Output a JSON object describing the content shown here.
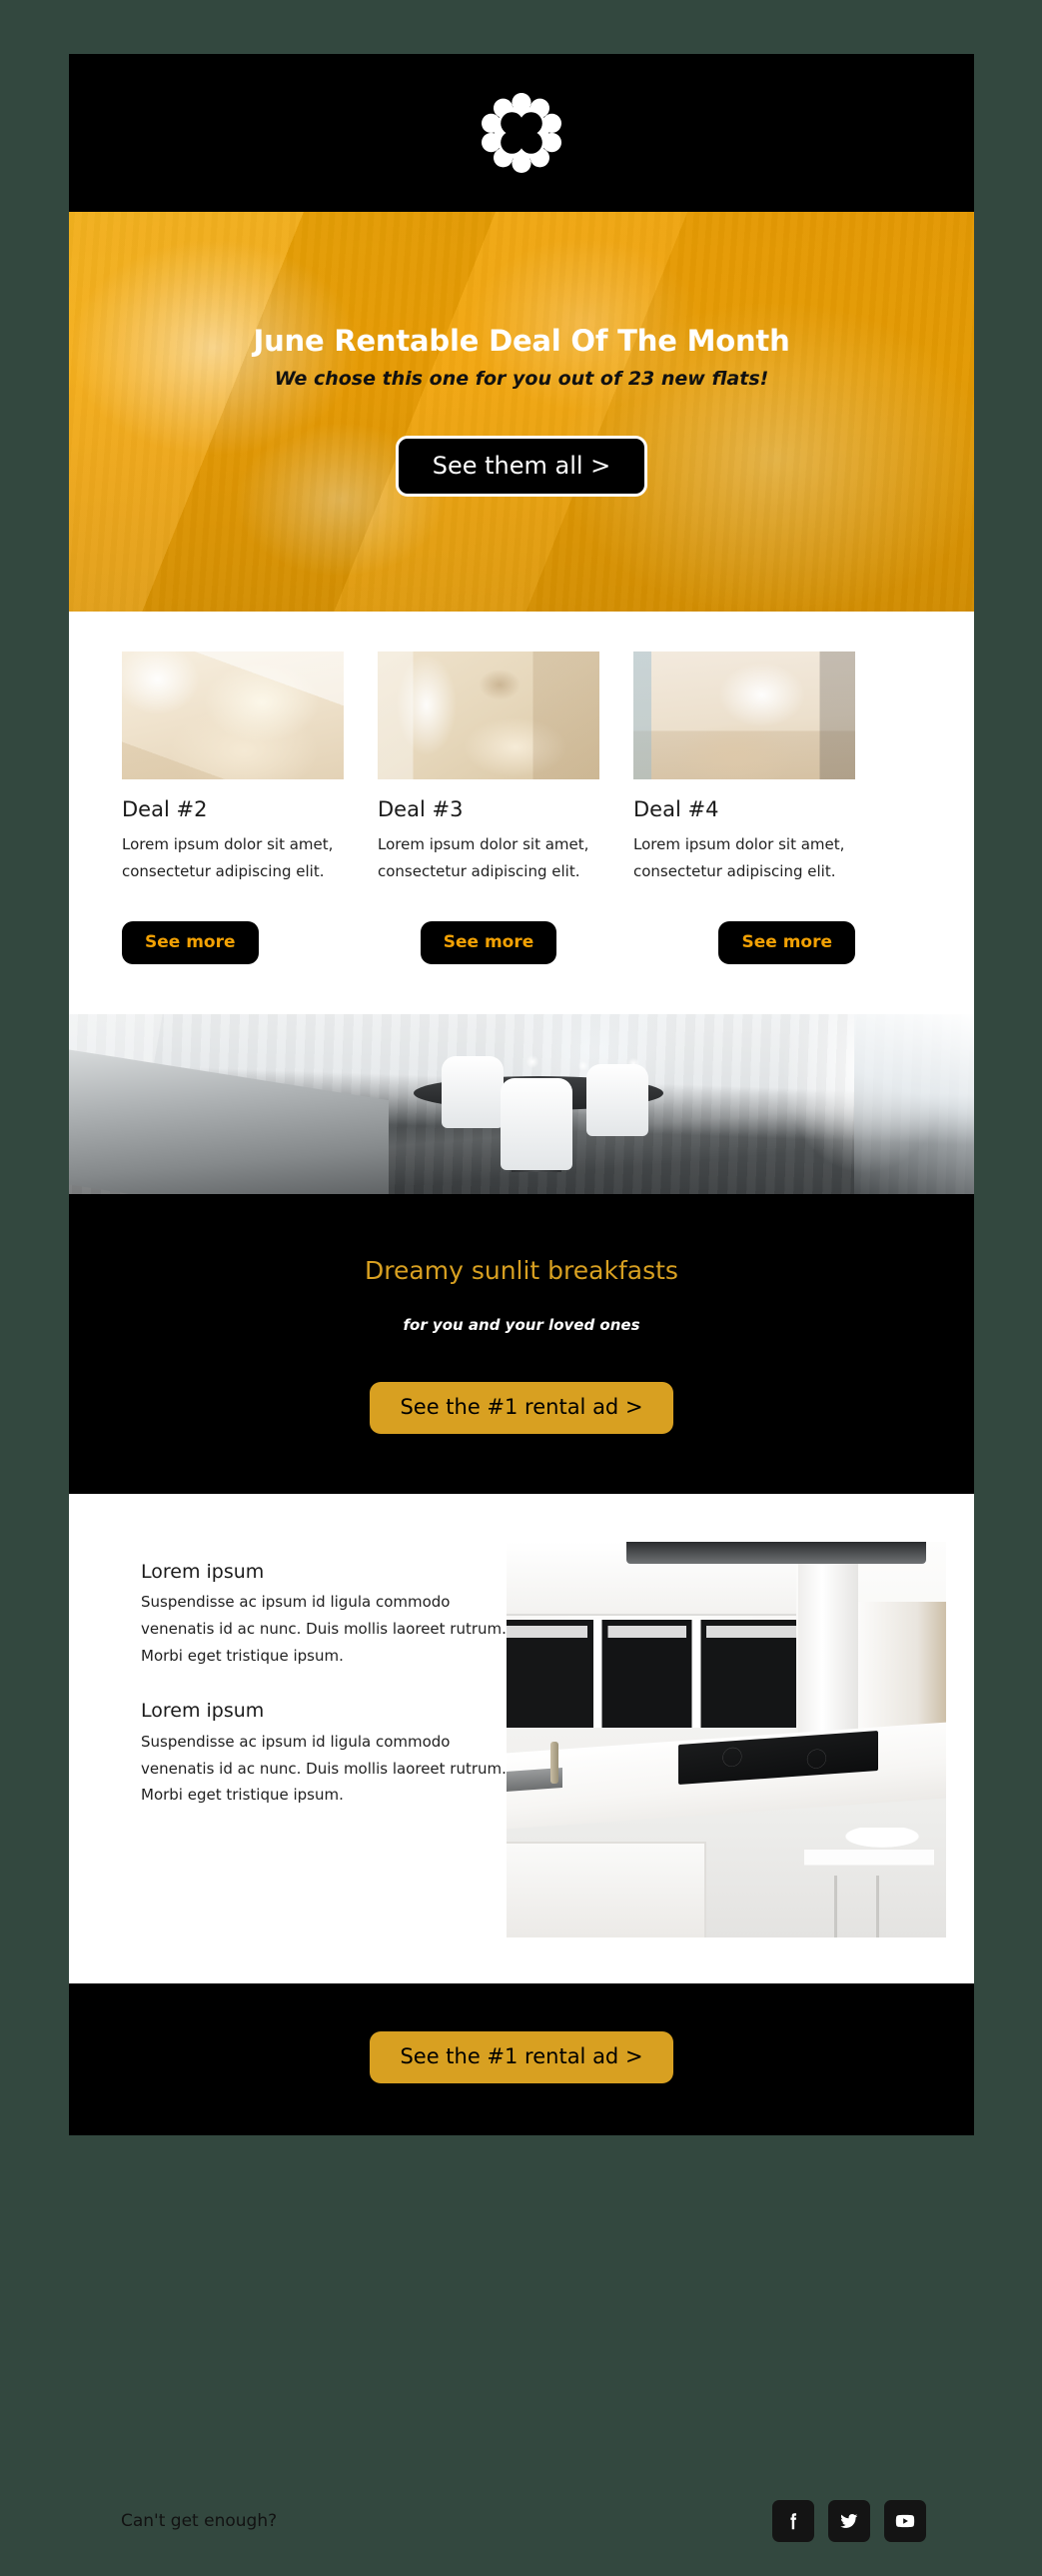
{
  "theme": {
    "page_background": "#33483f",
    "email_background": "#ffffff",
    "black": "#000000",
    "hero_yellow": "#f2a204",
    "accent_gold": "#d8a021",
    "see_more_text": "#f2a104"
  },
  "header": {
    "logo_icon": "flower-scallop-logo"
  },
  "hero": {
    "title": "June Rentable Deal Of The Month",
    "subtitle": "We chose this one for you out of 23 new flats!",
    "cta_label": "See them all >",
    "image_alt": "yellow-tinted-bedroom-photo"
  },
  "deals": {
    "items": [
      {
        "title": "Deal #2",
        "body": "Lorem ipsum dolor sit amet, consectetur adipiscing elit.",
        "button_label": "See more",
        "image_alt": "beige-bedroom-thumbnail"
      },
      {
        "title": "Deal #3",
        "body": "Lorem ipsum dolor sit amet, consectetur adipiscing elit.",
        "button_label": "See more",
        "image_alt": "living-room-with-tree-art-thumbnail"
      },
      {
        "title": "Deal #4",
        "body": "Lorem ipsum dolor sit amet, consectetur adipiscing elit.",
        "button_label": "See more",
        "image_alt": "modern-open-living-space-thumbnail"
      }
    ]
  },
  "banner": {
    "image_alt": "modern-dining-room-photo"
  },
  "dark_section": {
    "title": "Dreamy sunlit breakfasts",
    "subtitle": "for you and your loved ones",
    "cta_label": "See the #1 rental ad >"
  },
  "content": {
    "blocks": [
      {
        "title": "Lorem ipsum",
        "body": "Suspendisse ac ipsum id ligula commodo venenatis id ac nunc. Duis mollis laoreet rutrum. Morbi eget tristique ipsum."
      },
      {
        "title": "Lorem ipsum",
        "body": "Suspendisse ac ipsum id ligula commodo venenatis id ac nunc. Duis mollis laoreet rutrum. Morbi eget tristique ipsum."
      }
    ],
    "image_alt": "white-modern-kitchen-photo"
  },
  "bottom_cta": {
    "cta_label": "See the #1 rental ad >"
  },
  "footer": {
    "text": "Can't get enough?",
    "socials": [
      {
        "name": "facebook",
        "icon": "facebook-icon"
      },
      {
        "name": "twitter",
        "icon": "twitter-icon"
      },
      {
        "name": "youtube",
        "icon": "youtube-icon"
      }
    ]
  }
}
